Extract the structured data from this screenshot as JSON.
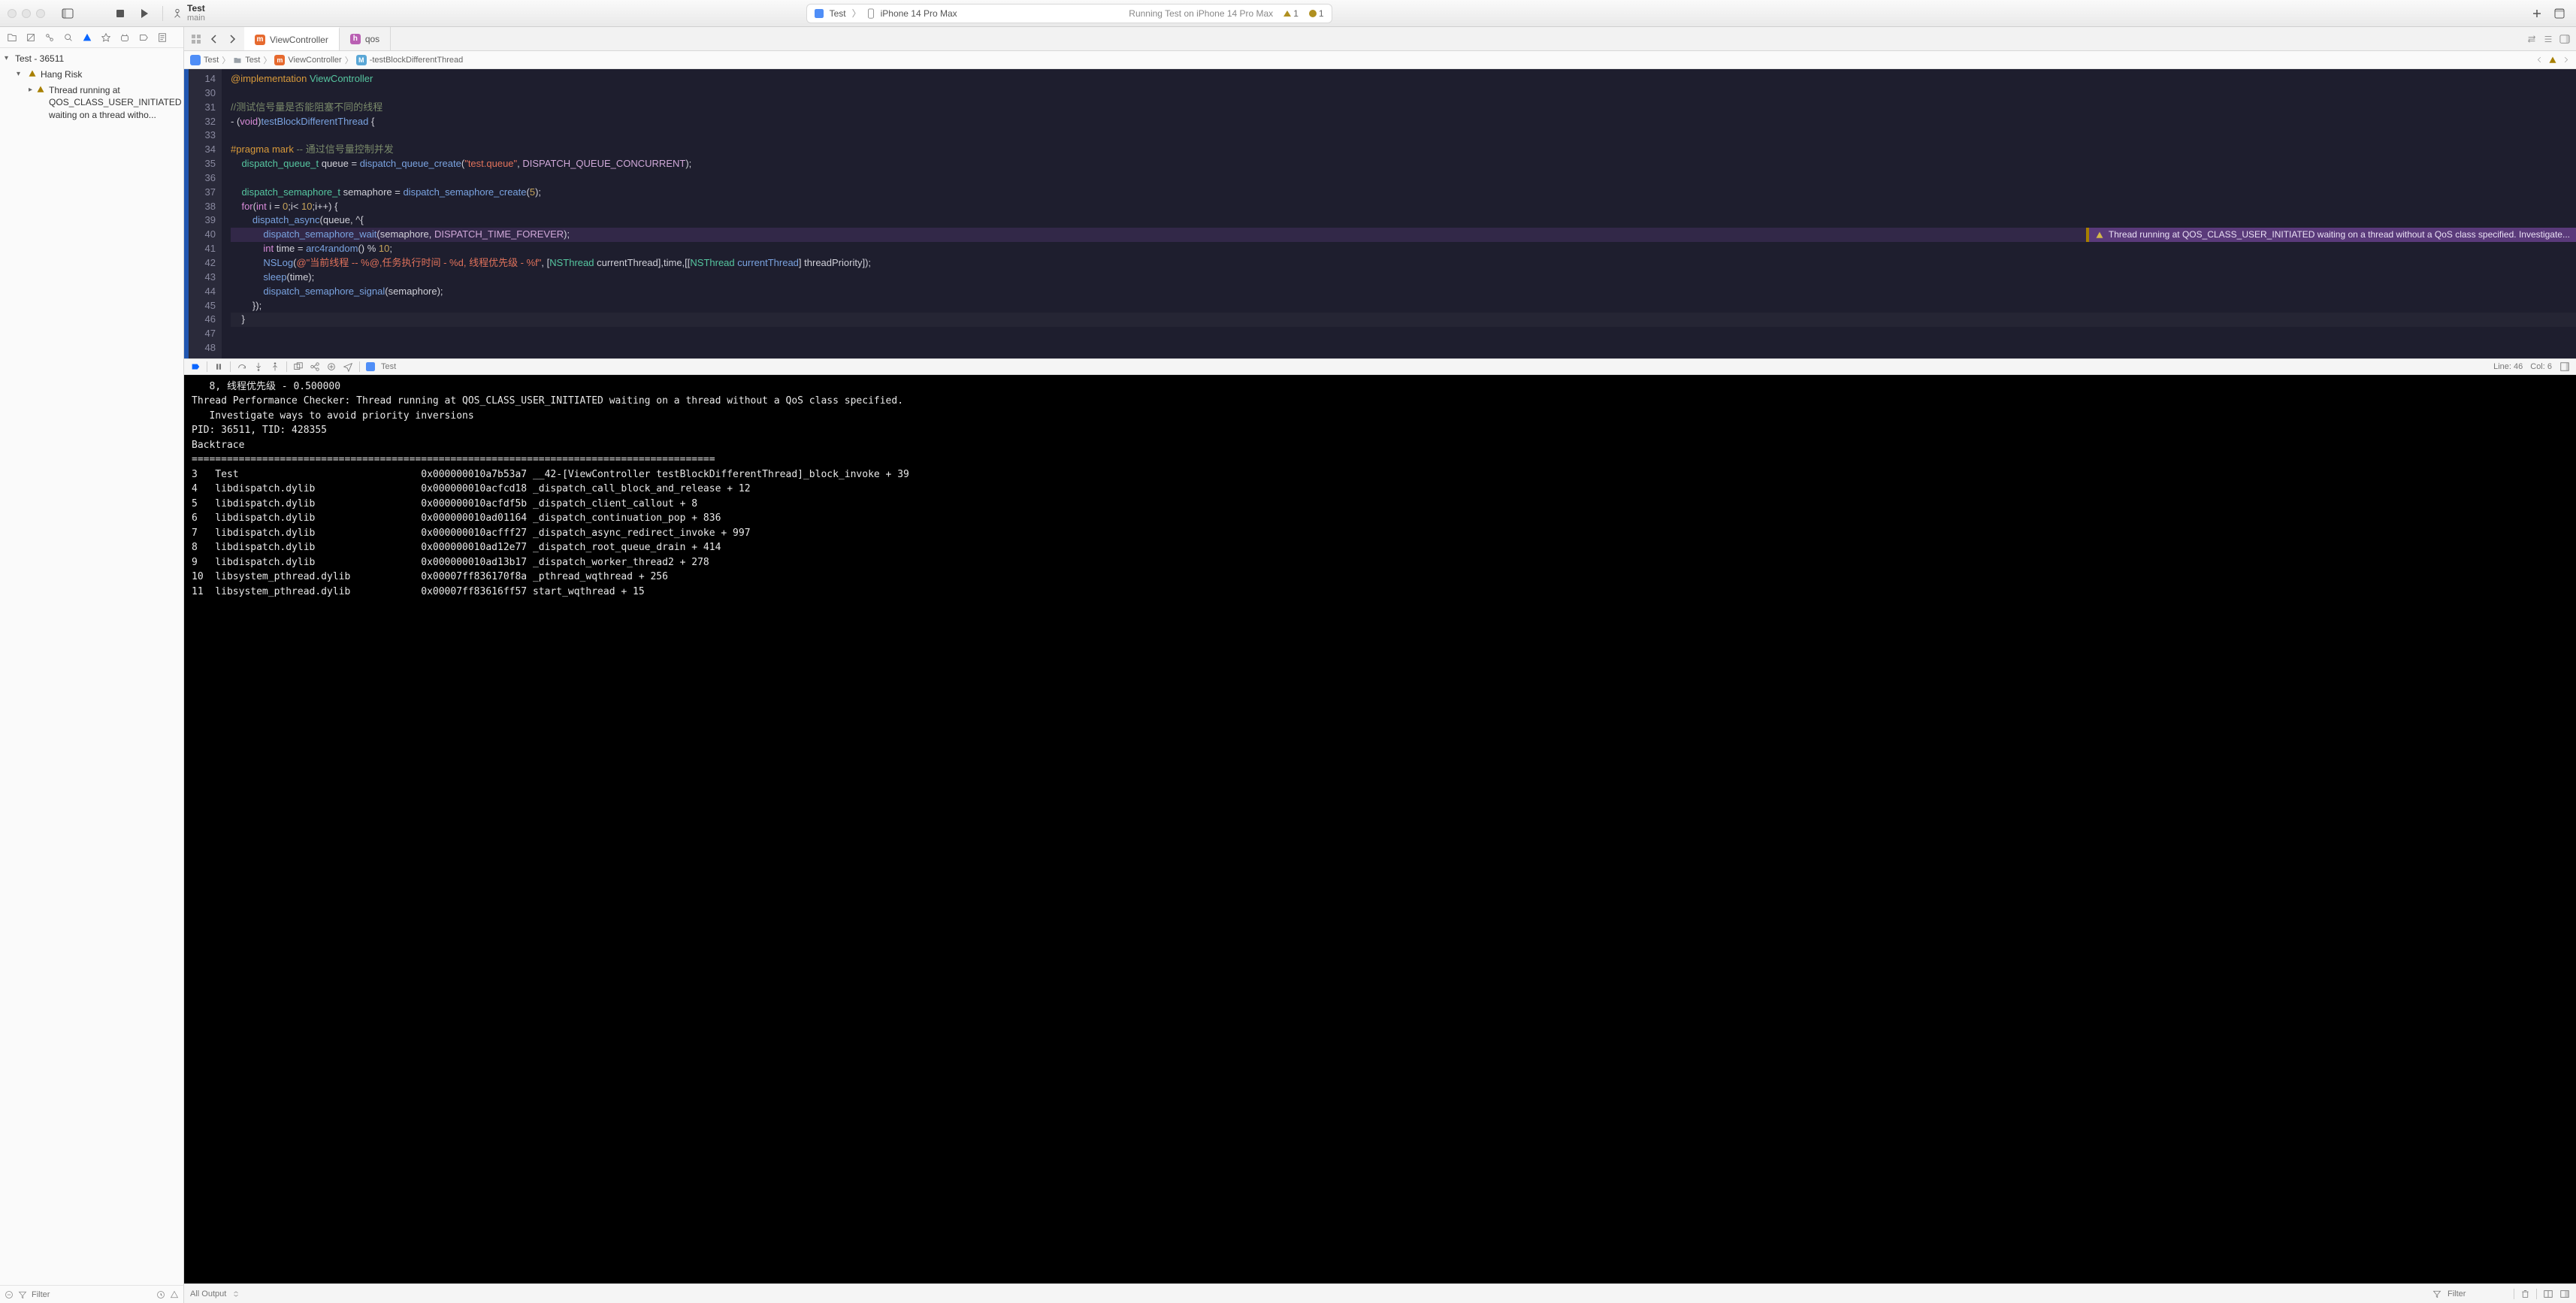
{
  "window": {
    "scheme_name": "Test",
    "scheme_branch": "main"
  },
  "pill": {
    "app_name": "Test",
    "device": "iPhone 14 Pro Max",
    "status": "Running Test on iPhone 14 Pro Max",
    "warn_count": "1",
    "runtime_count": "1"
  },
  "sidebar": {
    "root": "Test - 36511",
    "group": "Hang Risk",
    "issue": "Thread running at QOS_CLASS_USER_INITIATED waiting on a thread witho...",
    "filter_placeholder": "Filter"
  },
  "tabs": {
    "t1": "ViewController",
    "t2": "qos"
  },
  "breadcrumb": {
    "p1": "Test",
    "p2": "Test",
    "p3": "ViewController",
    "p4": "-testBlockDifferentThread"
  },
  "code": {
    "lines": [
      {
        "n": "14",
        "html": "<span class='tok-mac'>@implementation</span> <span class='tok-type'>ViewController</span>"
      },
      {
        "n": "30",
        "html": ""
      },
      {
        "n": "31",
        "html": "<span class='tok-cmt'>//测试信号量是否能阻塞不同的线程</span>"
      },
      {
        "n": "32",
        "html": "- (<span class='tok-kw'>void</span>)<span class='tok-fn'>testBlockDifferentThread</span> {"
      },
      {
        "n": "33",
        "html": ""
      },
      {
        "n": "34",
        "html": "<span class='tok-mac'>#pragma</span> <span class='tok-mac'>mark</span> <span class='tok-cmt'>-- 通过信号量控制并发</span>"
      },
      {
        "n": "35",
        "html": "    <span class='tok-type'>dispatch_queue_t</span> queue = <span class='tok-fn'>dispatch_queue_create</span>(<span class='tok-str'>\"test.queue\"</span>, <span class='tok-const'>DISPATCH_QUEUE_CONCURRENT</span>);"
      },
      {
        "n": "36",
        "html": ""
      },
      {
        "n": "37",
        "html": "    <span class='tok-type'>dispatch_semaphore_t</span> semaphore = <span class='tok-fn'>dispatch_semaphore_create</span>(<span class='tok-num'>5</span>);"
      },
      {
        "n": "38",
        "html": "    <span class='tok-kw'>for</span>(<span class='tok-kw'>int</span> i = <span class='tok-num'>0</span>;i&lt; <span class='tok-num'>10</span>;i++) {"
      },
      {
        "n": "39",
        "html": "        <span class='tok-fn'>dispatch_async</span>(queue, ^{"
      },
      {
        "n": "40",
        "html": "            <span class='tok-fn'>dispatch_semaphore_wait</span>(semaphore, <span class='tok-const'>DISPATCH_TIME_FOREVER</span>);",
        "hl": true,
        "warn": true
      },
      {
        "n": "41",
        "html": "            <span class='tok-kw'>int</span> time = <span class='tok-fn'>arc4random</span>() % <span class='tok-num'>10</span>;"
      },
      {
        "n": "42",
        "html": "            <span class='tok-fn'>NSLog</span>(<span class='tok-str'>@\"当前线程 -- %@,任务执行时间 - %d, 线程优先级 - %f\"</span>, [<span class='tok-type'>NSThread</span> currentThread],time,[[<span class='tok-type'>NSThread</span> <span class='tok-fn'>currentThread</span>] threadPriority]);"
      },
      {
        "n": "43",
        "html": "            <span class='tok-fn'>sleep</span>(time);"
      },
      {
        "n": "44",
        "html": "            <span class='tok-fn'>dispatch_semaphore_signal</span>(semaphore);"
      },
      {
        "n": "45",
        "html": "        });"
      },
      {
        "n": "46",
        "html": "    }",
        "cur": true
      },
      {
        "n": "47",
        "html": ""
      },
      {
        "n": "48",
        "html": ""
      }
    ],
    "inline_warning": "Thread running at QOS_CLASS_USER_INITIATED waiting on a thread without a QoS class specified. Investigate..."
  },
  "ministatus": {
    "target": "Test",
    "line": "Line: 46",
    "col": "Col: 6"
  },
  "console_text": "   8, 线程优先级 - 0.500000\nThread Performance Checker: Thread running at QOS_CLASS_USER_INITIATED waiting on a thread without a QoS class specified.\n   Investigate ways to avoid priority inversions\nPID: 36511, TID: 428355\nBacktrace\n=========================================================================================\n3   Test                               0x000000010a7b53a7 __42-[ViewController testBlockDifferentThread]_block_invoke + 39\n4   libdispatch.dylib                  0x000000010acfcd18 _dispatch_call_block_and_release + 12\n5   libdispatch.dylib                  0x000000010acfdf5b _dispatch_client_callout + 8\n6   libdispatch.dylib                  0x000000010ad01164 _dispatch_continuation_pop + 836\n7   libdispatch.dylib                  0x000000010acfff27 _dispatch_async_redirect_invoke + 997\n8   libdispatch.dylib                  0x000000010ad12e77 _dispatch_root_queue_drain + 414\n9   libdispatch.dylib                  0x000000010ad13b17 _dispatch_worker_thread2 + 278\n10  libsystem_pthread.dylib            0x00007ff836170f8a _pthread_wqthread + 256\n11  libsystem_pthread.dylib            0x00007ff83616ff57 start_wqthread + 15",
  "console_bottom": {
    "output": "All Output",
    "filter": "Filter"
  }
}
